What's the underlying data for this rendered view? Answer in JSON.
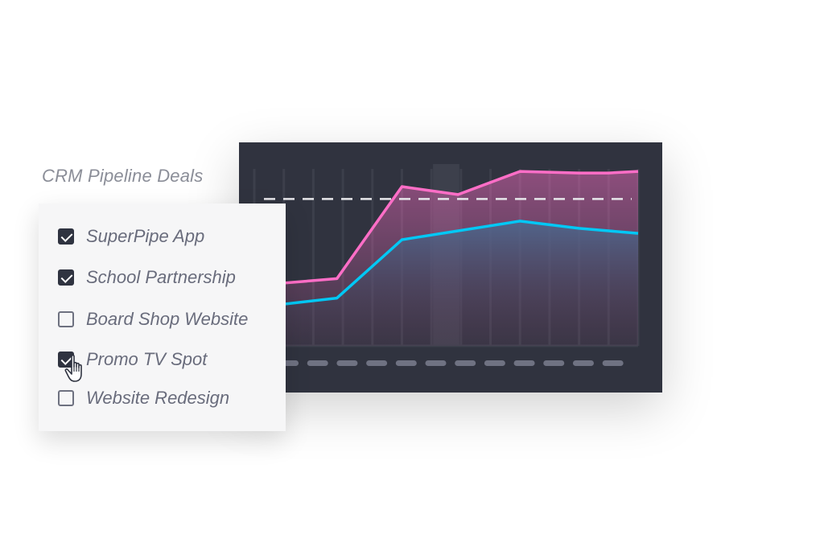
{
  "widget": {
    "title": "CRM Pipeline Deals",
    "filters": [
      {
        "label": "SuperPipe App",
        "checked": true
      },
      {
        "label": "School Partnership",
        "checked": true
      },
      {
        "label": "Board Shop Website",
        "checked": false
      },
      {
        "label": "Promo TV Spot",
        "checked": true
      },
      {
        "label": "Website Redesign",
        "checked": false
      }
    ],
    "cursor_icon": "hand-pointer-icon"
  },
  "colors": {
    "panel_bg": "#30333f",
    "pink": "#ff6ec7",
    "blue": "#00c8f5",
    "checkbox_checked": "#2f3340"
  },
  "chart_data": {
    "type": "area",
    "title": "",
    "xlabel": "",
    "ylabel": "",
    "grid": true,
    "x_count": 14,
    "xlim": [
      0,
      13
    ],
    "ylim": [
      0,
      100
    ],
    "x_tick_labels_hidden": true,
    "highlighted_column": 6,
    "target_line": 83,
    "series": [
      {
        "name": "pink",
        "color": "#ff6ec7",
        "x": [
          0,
          1,
          2.8,
          5,
          6.9,
          9,
          11,
          12,
          13
        ],
        "values": [
          34,
          35.5,
          38,
          90,
          85.5,
          98.6,
          97.7,
          97.7,
          98.6
        ]
      },
      {
        "name": "blue",
        "color": "#00c8f5",
        "x": [
          0,
          1,
          2.8,
          5,
          6.9,
          9,
          11,
          13
        ],
        "values": [
          22,
          23.6,
          27,
          60,
          65,
          70.5,
          66.4,
          63.6
        ]
      }
    ]
  }
}
